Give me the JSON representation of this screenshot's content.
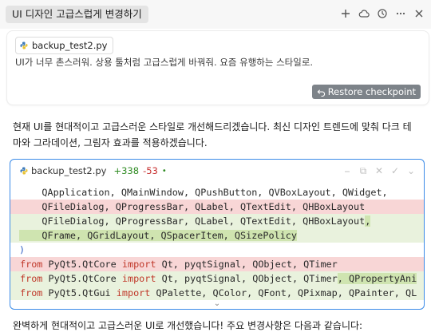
{
  "header": {
    "title": "UI 디자인 고급스럽게 변경하기",
    "icons": [
      "plus-icon",
      "cloud-icon",
      "history-icon",
      "more-icon",
      "close-icon"
    ]
  },
  "user_message": {
    "file_chip": "backup_test2.py",
    "text": "UI가 너무 촌스러워. 상용 툴처럼 고급스럽게 바꿔줘. 요즘 유행하는 스타일로.",
    "restore_label": "Restore checkpoint"
  },
  "assistant": {
    "intro_line1": "현재 UI를 현대적이고 고급스러운 스타일로 개선해드리겠습니다. 최신 디자인 트렌드에 맞춰 다크 테",
    "intro_line2": "마와 그라데이션, 그림자 효과를 적용하겠습니다.",
    "outro": "완벽하게 현대적이고 고급스러운 UI로 개선했습니다! 주요 변경사항은 다음과 같습니다:"
  },
  "code_block": {
    "filename": "backup_test2.py",
    "additions": "+338",
    "deletions": "-53",
    "dot": "•",
    "tools": [
      "⎯",
      "⧉",
      "✕",
      "✓",
      "⌄"
    ],
    "lines": [
      {
        "type": "ctx",
        "text": "    QApplication, QMainWindow, QPushButton, QVBoxLayout, QWidget,"
      },
      {
        "type": "del",
        "text": "    QFileDialog, QProgressBar, QLabel, QTextEdit, QHBoxLayout"
      },
      {
        "type": "add",
        "text": "    QFileDialog, QProgressBar, QLabel, QTextEdit, QHBoxLayout",
        "seg": ","
      },
      {
        "type": "add",
        "text": "    QFrame, QGridLayout, QSpacerItem, QSizePolicy",
        "seg": ""
      },
      {
        "type": "ctx",
        "text": ")"
      },
      {
        "type": "del",
        "kw1": "from",
        "mod": " PyQt5.QtCore ",
        "kw2": "import",
        "rest": " Qt, pyqtSignal, QObject, QTimer"
      },
      {
        "type": "add",
        "kw1": "from",
        "mod": " PyQt5.QtCore ",
        "kw2": "import",
        "rest": " Qt, pyqtSignal, QObject, QTimer",
        "seg": ", QPropertyAni"
      },
      {
        "type": "add",
        "kw1": "from",
        "mod": " PyQt5.QtGui ",
        "kw2": "import",
        "rest": " QPalette, QColor, QFont, QPixmap, QPainter, QL",
        "seg": ""
      }
    ]
  },
  "colors": {
    "accent_border": "#3b8be8",
    "deleted_bg": "#f8d6d6",
    "added_bg": "#e9f2dd",
    "added_highlight": "#cfe4b0",
    "additions_text": "#2e8b22",
    "deletions_text": "#c62b2b",
    "restore_bg": "#7d8389"
  }
}
